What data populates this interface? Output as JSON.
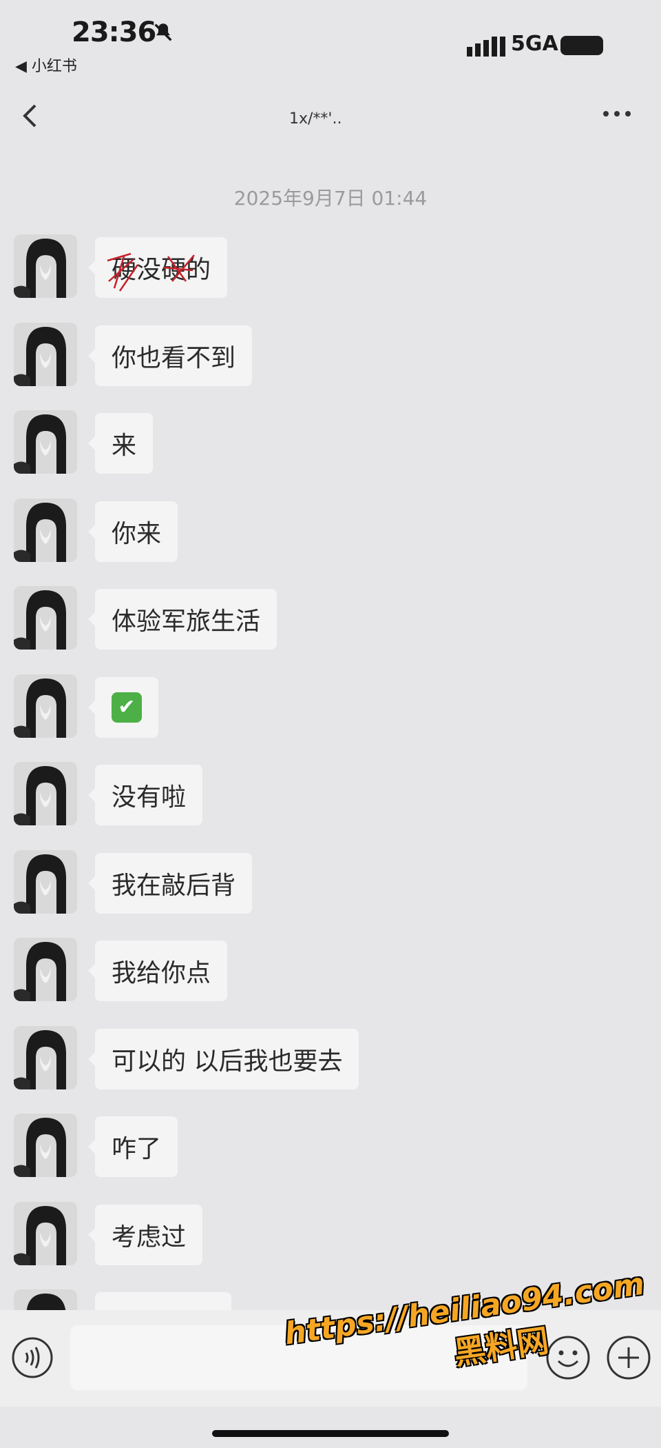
{
  "status_bar": {
    "time": "23:36",
    "back_app": "◀ 小红书",
    "network": "5GA"
  },
  "nav": {
    "title": "1x/**'..",
    "back_icon": "chevron-left-icon",
    "more_icon": "more-dots-icon"
  },
  "timestamp": "2025年9月7日 01:44",
  "messages": [
    {
      "text": "硬没硬的"
    },
    {
      "text": "你也看不到"
    },
    {
      "text": "来"
    },
    {
      "text": "你来"
    },
    {
      "text": "体验军旅生活"
    },
    {
      "text": "✔",
      "emoji": "check-mark-button"
    },
    {
      "text": "没有啦"
    },
    {
      "text": "我在敲后背"
    },
    {
      "text": "我给你点"
    },
    {
      "text": "可以的 以后我也要去"
    },
    {
      "text": "咋了"
    },
    {
      "text": "考虑过"
    },
    {
      "text": ""
    }
  ],
  "input_bar": {
    "voice_icon": "voice-icon",
    "emoji_icon": "emoji-icon",
    "plus_icon": "plus-icon"
  },
  "watermark": {
    "url": "https://heiliao94.com",
    "name": "黑料网"
  },
  "colors": {
    "background": "#e6e6e8",
    "bubble": "#f4f4f4",
    "check_green": "#4cb046",
    "watermark": "#f5a623"
  }
}
